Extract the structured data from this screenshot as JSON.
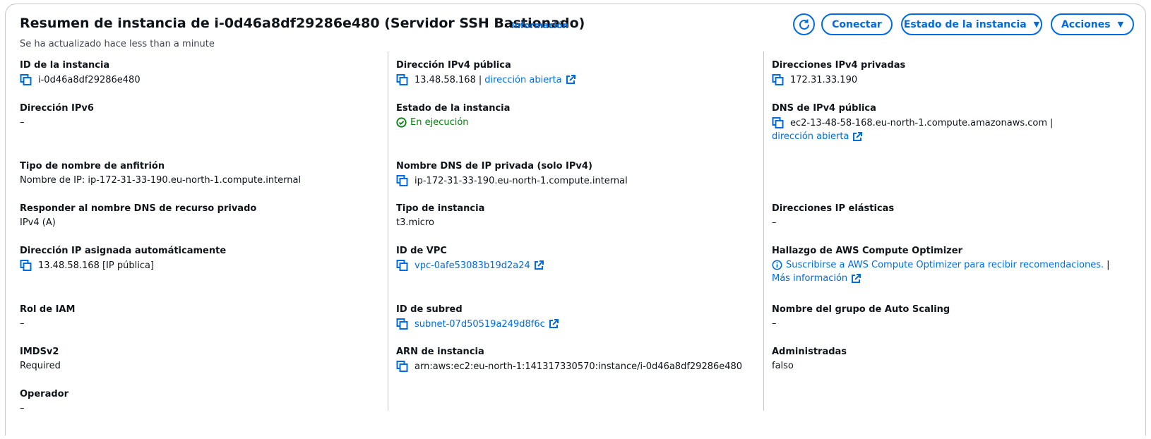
{
  "header": {
    "title": "Resumen de instancia de i-0d46a8df29286e480 (Servidor SSH Bastionado)",
    "info_link": "Información",
    "updated": "Se ha actualizado hace less than a minute",
    "buttons": {
      "connect": "Conectar",
      "instance_state": "Estado de la instancia",
      "actions": "Acciones"
    }
  },
  "col1": {
    "instance_id": {
      "label": "ID de la instancia",
      "value": "i-0d46a8df29286e480"
    },
    "ipv6": {
      "label": "Dirección IPv6",
      "value": "–"
    },
    "hostname_type": {
      "label": "Tipo de nombre de anfitrión",
      "value": "Nombre de IP: ip-172-31-33-190.eu-north-1.compute.internal"
    },
    "resource_dns": {
      "label": "Responder al nombre DNS de recurso privado",
      "value": "IPv4 (A)"
    },
    "auto_ip": {
      "label": "Dirección IP asignada automáticamente",
      "value": "13.48.58.168 [IP pública]"
    },
    "iam_role": {
      "label": "Rol de IAM",
      "value": "–"
    },
    "imdsv2": {
      "label": "IMDSv2",
      "value": "Required"
    },
    "operator": {
      "label": "Operador",
      "value": "–"
    }
  },
  "col2": {
    "public_ipv4": {
      "label": "Dirección IPv4 pública",
      "value": "13.48.58.168",
      "separator": "|",
      "link": "dirección abierta"
    },
    "instance_state": {
      "label": "Estado de la instancia",
      "value": "En ejecución"
    },
    "private_dns": {
      "label": "Nombre DNS de IP privada (solo IPv4)",
      "value": "ip-172-31-33-190.eu-north-1.compute.internal"
    },
    "instance_type": {
      "label": "Tipo de instancia",
      "value": "t3.micro"
    },
    "vpc_id": {
      "label": "ID de VPC",
      "value": "vpc-0afe53083b19d2a24"
    },
    "subnet_id": {
      "label": "ID de subred",
      "value": "subnet-07d50519a249d8f6c"
    },
    "arn": {
      "label": "ARN de instancia",
      "value": "arn:aws:ec2:eu-north-1:141317330570:instance/i-0d46a8df29286e480"
    }
  },
  "col3": {
    "private_ipv4": {
      "label": "Direcciones IPv4 privadas",
      "value": "172.31.33.190"
    },
    "public_dns": {
      "label": "DNS de IPv4 pública",
      "value": "ec2-13-48-58-168.eu-north-1.compute.amazonaws.com",
      "separator": "|",
      "link": "dirección abierta"
    },
    "elastic_ip": {
      "label": "Direcciones IP elásticas",
      "value": "–"
    },
    "optimizer": {
      "label": "Hallazgo de AWS Compute Optimizer",
      "value": "Suscribirse a AWS Compute Optimizer para recibir recomendaciones.",
      "separator": "|",
      "link": "Más información"
    },
    "asg_name": {
      "label": "Nombre del grupo de Auto Scaling",
      "value": "–"
    },
    "managed": {
      "label": "Administradas",
      "value": "falso"
    }
  },
  "colors": {
    "accent": "#006ce0",
    "success": "#037f0c",
    "text": "#0f141a",
    "border": "#c6c6cd"
  }
}
